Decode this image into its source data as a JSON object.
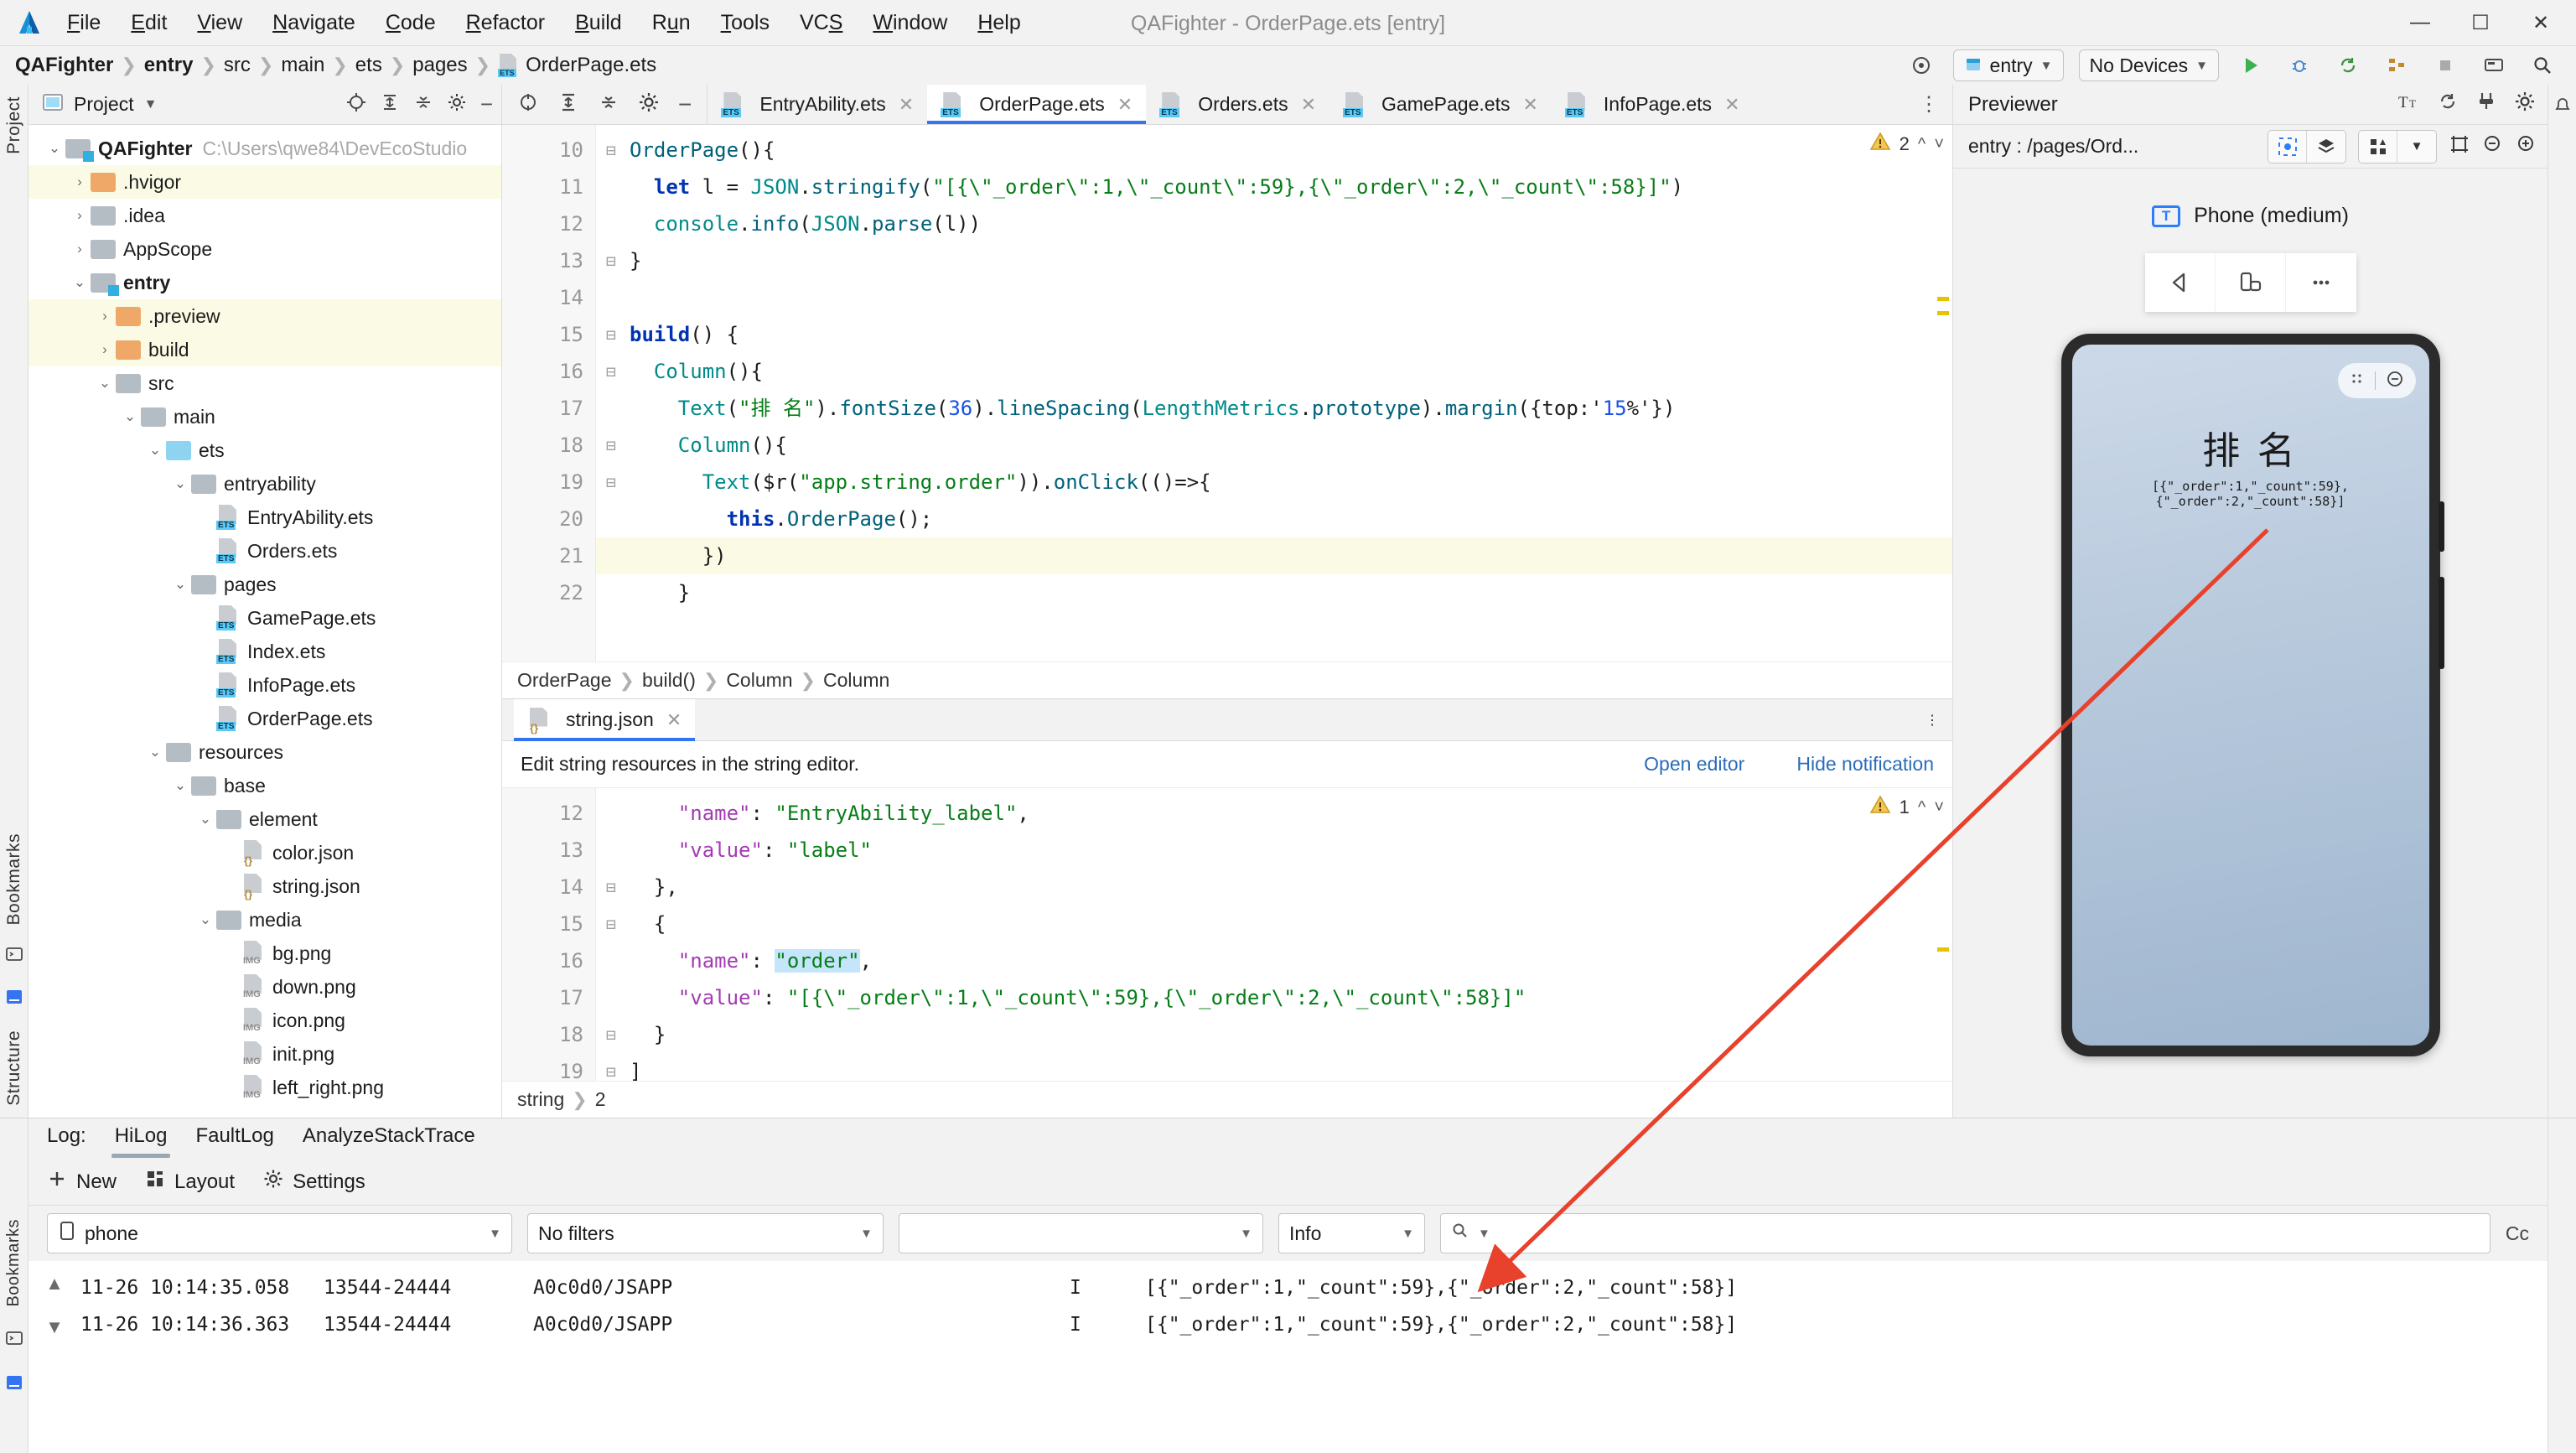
{
  "window": {
    "title": "QAFighter - OrderPage.ets [entry]",
    "minimize": "—",
    "maximize": "☐",
    "close": "✕"
  },
  "menu": [
    {
      "label": "File",
      "mnemonic": "F"
    },
    {
      "label": "Edit",
      "mnemonic": "E"
    },
    {
      "label": "View",
      "mnemonic": "V"
    },
    {
      "label": "Navigate",
      "mnemonic": "N"
    },
    {
      "label": "Code",
      "mnemonic": "C"
    },
    {
      "label": "Refactor",
      "mnemonic": "R"
    },
    {
      "label": "Build",
      "mnemonic": "B"
    },
    {
      "label": "Run",
      "mnemonic": "u"
    },
    {
      "label": "Tools",
      "mnemonic": "T"
    },
    {
      "label": "VCS",
      "mnemonic": "S"
    },
    {
      "label": "Window",
      "mnemonic": "W"
    },
    {
      "label": "Help",
      "mnemonic": "H"
    }
  ],
  "breadcrumb": [
    "QAFighter",
    "entry",
    "src",
    "main",
    "ets",
    "pages",
    "OrderPage.ets"
  ],
  "toolbar": {
    "run_config": "entry",
    "device": "No Devices",
    "run_label": "▶",
    "debug_label": "🐞",
    "sync_label": "↻",
    "struct_label": "▦",
    "stop_label": "■",
    "device_manager": "▤",
    "search": "🔍",
    "target_icon": "⊕"
  },
  "project": {
    "title": "Project",
    "tree": [
      {
        "depth": 0,
        "chev": "⌄",
        "icon": "folder-mod",
        "label": "QAFighter",
        "bold": true,
        "path": "C:\\Users\\qwe84\\DevEcoStudio",
        "hl": false
      },
      {
        "depth": 1,
        "chev": "›",
        "icon": "folder-orange",
        "label": ".hvigor",
        "hl": true
      },
      {
        "depth": 1,
        "chev": "›",
        "icon": "folder",
        "label": ".idea",
        "hl": false
      },
      {
        "depth": 1,
        "chev": "›",
        "icon": "folder",
        "label": "AppScope",
        "hl": false
      },
      {
        "depth": 1,
        "chev": "⌄",
        "icon": "folder-mod",
        "label": "entry",
        "bold": true,
        "hl": false
      },
      {
        "depth": 2,
        "chev": "›",
        "icon": "folder-orange",
        "label": ".preview",
        "hl": true
      },
      {
        "depth": 2,
        "chev": "›",
        "icon": "folder-orange",
        "label": "build",
        "hl": true
      },
      {
        "depth": 2,
        "chev": "⌄",
        "icon": "folder",
        "label": "src",
        "hl": false
      },
      {
        "depth": 3,
        "chev": "⌄",
        "icon": "folder",
        "label": "main",
        "hl": false
      },
      {
        "depth": 4,
        "chev": "⌄",
        "icon": "folder-blue",
        "label": "ets",
        "hl": false
      },
      {
        "depth": 5,
        "chev": "⌄",
        "icon": "folder",
        "label": "entryability",
        "hl": false
      },
      {
        "depth": 6,
        "chev": "",
        "icon": "ets",
        "label": "EntryAbility.ets",
        "hl": false
      },
      {
        "depth": 6,
        "chev": "",
        "icon": "ets",
        "label": "Orders.ets",
        "hl": false
      },
      {
        "depth": 5,
        "chev": "⌄",
        "icon": "folder",
        "label": "pages",
        "hl": false
      },
      {
        "depth": 6,
        "chev": "",
        "icon": "ets",
        "label": "GamePage.ets",
        "hl": false
      },
      {
        "depth": 6,
        "chev": "",
        "icon": "ets",
        "label": "Index.ets",
        "hl": false
      },
      {
        "depth": 6,
        "chev": "",
        "icon": "ets",
        "label": "InfoPage.ets",
        "hl": false
      },
      {
        "depth": 6,
        "chev": "",
        "icon": "ets",
        "label": "OrderPage.ets",
        "hl": false
      },
      {
        "depth": 4,
        "chev": "⌄",
        "icon": "folder",
        "label": "resources",
        "hl": false
      },
      {
        "depth": 5,
        "chev": "⌄",
        "icon": "folder",
        "label": "base",
        "hl": false
      },
      {
        "depth": 6,
        "chev": "⌄",
        "icon": "folder",
        "label": "element",
        "hl": false
      },
      {
        "depth": 7,
        "chev": "",
        "icon": "json",
        "label": "color.json",
        "hl": false
      },
      {
        "depth": 7,
        "chev": "",
        "icon": "json",
        "label": "string.json",
        "hl": false
      },
      {
        "depth": 6,
        "chev": "⌄",
        "icon": "folder",
        "label": "media",
        "hl": false
      },
      {
        "depth": 7,
        "chev": "",
        "icon": "png",
        "label": "bg.png",
        "hl": false
      },
      {
        "depth": 7,
        "chev": "",
        "icon": "png",
        "label": "down.png",
        "hl": false
      },
      {
        "depth": 7,
        "chev": "",
        "icon": "png",
        "label": "icon.png",
        "hl": false
      },
      {
        "depth": 7,
        "chev": "",
        "icon": "png",
        "label": "init.png",
        "hl": false
      },
      {
        "depth": 7,
        "chev": "",
        "icon": "png",
        "label": "left_right.png",
        "hl": false
      }
    ]
  },
  "editor": {
    "tabs": [
      {
        "label": "EntryAbility.ets",
        "active": false
      },
      {
        "label": "OrderPage.ets",
        "active": true
      },
      {
        "label": "Orders.ets",
        "active": false
      },
      {
        "label": "GamePage.ets",
        "active": false
      },
      {
        "label": "InfoPage.ets",
        "active": false
      }
    ],
    "warning_count": "2",
    "lines": [
      {
        "n": "10",
        "fold": "⊟",
        "hl": false
      },
      {
        "n": "11",
        "fold": "",
        "hl": false
      },
      {
        "n": "12",
        "fold": "",
        "hl": false
      },
      {
        "n": "13",
        "fold": "⊟",
        "hl": false
      },
      {
        "n": "14",
        "fold": "",
        "hl": false
      },
      {
        "n": "15",
        "fold": "⊟",
        "hl": false
      },
      {
        "n": "16",
        "fold": "⊟",
        "hl": false
      },
      {
        "n": "17",
        "fold": "",
        "hl": false
      },
      {
        "n": "18",
        "fold": "⊟",
        "hl": false
      },
      {
        "n": "19",
        "fold": "⊟",
        "hl": false
      },
      {
        "n": "20",
        "fold": "",
        "hl": false
      },
      {
        "n": "21",
        "fold": "⊟",
        "hl": true
      },
      {
        "n": "22",
        "fold": "",
        "hl": false
      }
    ],
    "code_text": [
      "OrderPage(){",
      "  let l = JSON.stringify(\"[{\\\"_order\\\":1,\\\"_count\\\":59},{\\\"_order\\\":2,\\\"_count\\\":58}]\")",
      "  console.info(JSON.parse(l))",
      "}",
      "",
      "build() {",
      "  Column(){",
      "    Text(\"排 名\").fontSize(36).lineSpacing(LengthMetrics.prototype).margin({top:'15%'})",
      "    Column(){",
      "      Text($r(\"app.string.order\")).onClick(()=>{",
      "        this.OrderPage();",
      "      })",
      "    }"
    ],
    "breadcrumb2": [
      "OrderPage",
      "build()",
      "Column",
      "Column"
    ]
  },
  "json_editor": {
    "tab": "string.json",
    "notification": "Edit string resources in the string editor.",
    "open_editor": "Open editor",
    "hide_notification": "Hide notification",
    "warning_count": "1",
    "lines": [
      {
        "n": "12",
        "fold": "",
        "hl": false
      },
      {
        "n": "13",
        "fold": "",
        "hl": false
      },
      {
        "n": "14",
        "fold": "⊟",
        "hl": false
      },
      {
        "n": "15",
        "fold": "⊟",
        "hl": false
      },
      {
        "n": "16",
        "fold": "",
        "hl": false
      },
      {
        "n": "17",
        "fold": "",
        "hl": false
      },
      {
        "n": "18",
        "fold": "⊟",
        "hl": false
      },
      {
        "n": "19",
        "fold": "⊟",
        "hl": false
      }
    ],
    "breadcrumb": [
      "string",
      "2"
    ]
  },
  "previewer": {
    "title": "Previewer",
    "route": "entry : /pages/Ord...",
    "device_name": "Phone (medium)",
    "device_badge": "T",
    "phone": {
      "title": "排 名",
      "subtitle": "[{\"_order\":1,\"_count\":59},{\"_order\":2,\"_count\":58}]"
    }
  },
  "log": {
    "tabs": [
      {
        "label": "Log:",
        "active": false
      },
      {
        "label": "HiLog",
        "active": true
      },
      {
        "label": "FaultLog",
        "active": false
      },
      {
        "label": "AnalyzeStackTrace",
        "active": false
      }
    ],
    "tools": [
      {
        "label": "New",
        "icon": "plus-icon"
      },
      {
        "label": "Layout",
        "icon": "layout-icon"
      },
      {
        "label": "Settings",
        "icon": "gear-icon"
      }
    ],
    "filters": {
      "device": "phone",
      "filter": "No filters",
      "process": "",
      "level": "Info",
      "search_placeholder": "",
      "search_value": "",
      "right_label": "Cc"
    },
    "rows": [
      {
        "time": "11-26 10:14:35.058",
        "pid": "13544-24444",
        "tag": "A0c0d0/JSAPP",
        "level": "I",
        "message": "[{\"_order\":1,\"_count\":59},{\"_order\":2,\"_count\":58}]"
      },
      {
        "time": "11-26 10:14:36.363",
        "pid": "13544-24444",
        "tag": "A0c0d0/JSAPP",
        "level": "I",
        "message": "[{\"_order\":1,\"_count\":59},{\"_order\":2,\"_count\":58}]"
      }
    ]
  },
  "rails": {
    "left_top": "Project",
    "left_bottom": "Bookmarks",
    "left_bottom2": "Structure"
  },
  "colors": {
    "accent": "#3574f0",
    "warning": "#e6a700",
    "annotation": "#e8412c"
  }
}
